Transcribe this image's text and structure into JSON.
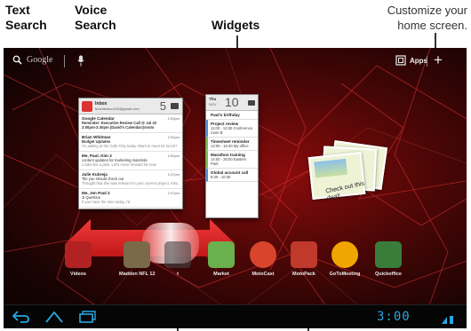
{
  "callouts": {
    "text_search": [
      "Text",
      "Search"
    ],
    "voice_search": [
      "Voice",
      "Search"
    ],
    "widgets": "Widgets",
    "customize": [
      "Customize your",
      "home screen."
    ]
  },
  "topbar": {
    "google_label": "Google",
    "apps_label": "Apps",
    "add_symbol": "+"
  },
  "gmail_widget": {
    "title": "Inbox",
    "account": "funinthesun100@gmail.com",
    "count": "5",
    "messages": [
      {
        "from": "Google Calendar",
        "time": "2:53pm",
        "subject": "Reminder: Executive Review Call @ Jul 22",
        "snippet": "3:00pm-3:30pm (David's Calendar@moto"
      },
      {
        "from": "Brian Whitman",
        "time": "2:52pm",
        "subject": "Budget Updates",
        "snippet": "I'm asking at the Cafe Frity today. Want to meet for lunch?"
      },
      {
        "from": "Me, Paul, Kim  3",
        "time": "2:50pm",
        "subject": "content updates for marketing materials",
        "snippet": "Looks like a plan. Let's move forward for now"
      },
      {
        "from": "Julie Kubreja",
        "time": "2:47pm",
        "subject": "Tile you should check out",
        "snippet": "Thought that this was relevant to your current project. Also,"
      },
      {
        "from": "Me, Jen Paul  2",
        "time": "2:47pm",
        "subject": "JI Question",
        "snippet": "If you have the time today, I'd"
      }
    ]
  },
  "calendar_widget": {
    "day": "Thu",
    "month": "NOV",
    "date": "10",
    "events": [
      {
        "title": "Paul's birthday",
        "detail": ""
      },
      {
        "title": "Project review",
        "detail": "11:00 - 13:30 Conference room B"
      },
      {
        "title": "Timesheet reminder",
        "detail": "14:00 - 16:30 My office"
      },
      {
        "title": "Marathon training",
        "detail": "14:00 - 20:00 Eastern Park"
      },
      {
        "title": "Global account call",
        "detail": "9:30 - 10:30"
      }
    ]
  },
  "photo_widget": {
    "caption": [
      "Check out this",
      "deal!"
    ]
  },
  "dock": [
    {
      "label": "Videos",
      "color": "#b22222"
    },
    {
      "label": "Madden NFL 12",
      "color": "#7a6a4a"
    },
    {
      "label": "t",
      "color": "#444444"
    },
    {
      "label": "Market",
      "color": "#6ab04c"
    },
    {
      "label": "MotoCast",
      "color": "#d9442c"
    },
    {
      "label": "MotoPack",
      "color": "#c0392b"
    },
    {
      "label": "GoToMeeting",
      "color": "#f0a500"
    },
    {
      "label": "Quickoffice",
      "color": "#3a7d3a"
    }
  ],
  "status": {
    "clock": "3:00"
  },
  "colors": {
    "accent": "#2aa7e0",
    "arrow": "#e02020",
    "background": "#5a0808"
  }
}
